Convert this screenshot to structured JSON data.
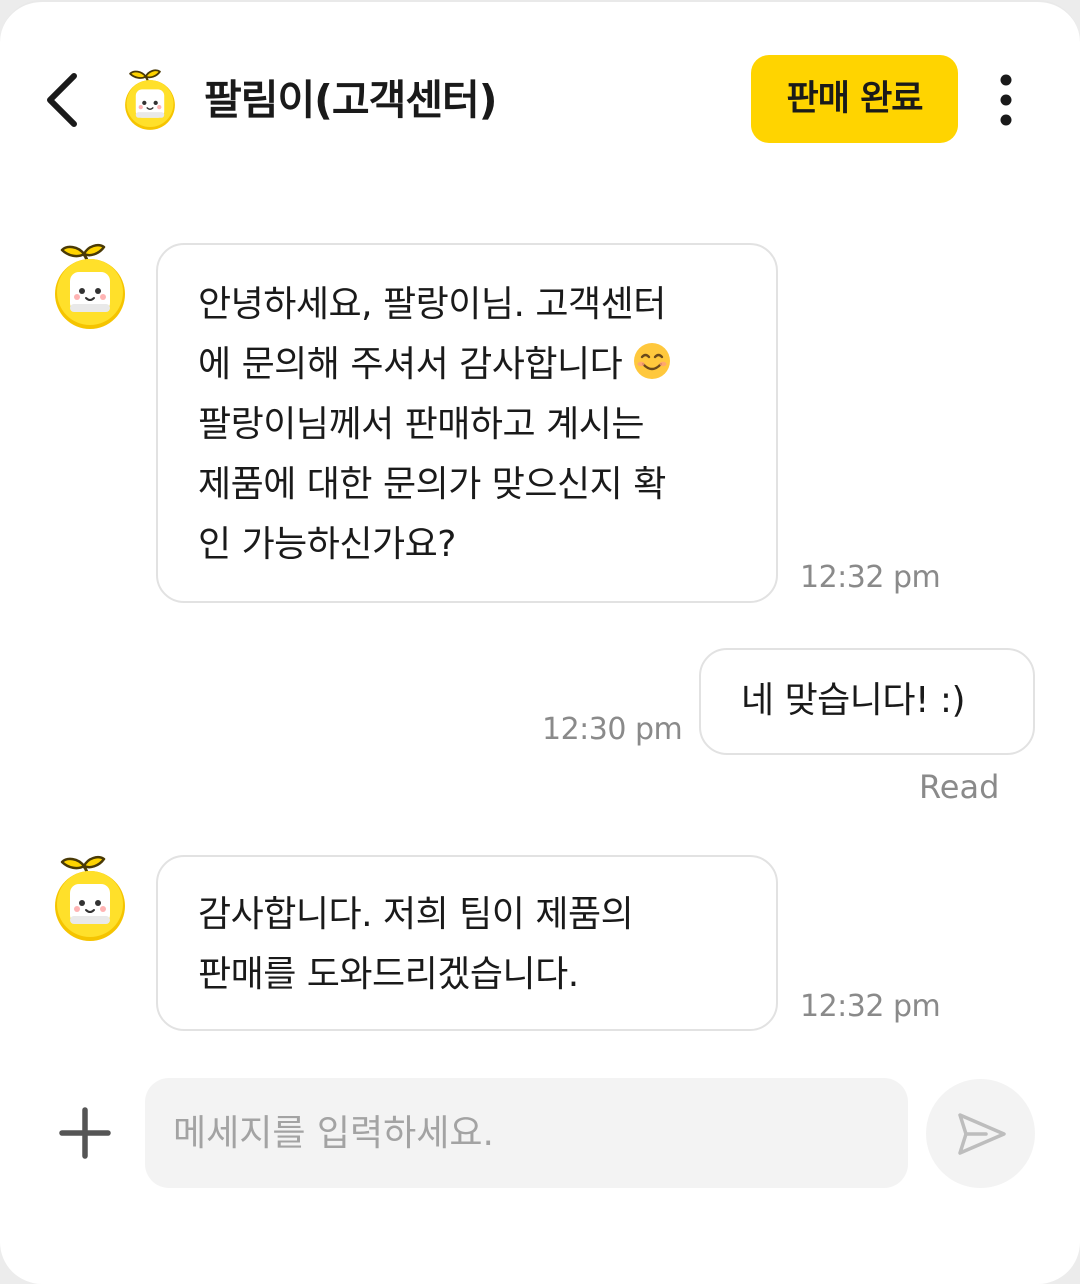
{
  "header": {
    "title": "팔림이(고객센터)",
    "action_label": "판매 완료",
    "back_icon": "chevron-left-icon",
    "menu_icon": "kebab-menu-icon",
    "avatar_icon": "mascot-avatar-icon"
  },
  "messages": [
    {
      "direction": "incoming",
      "lines": [
        "안녕하세요, 팔랑이님. 고객센터",
        "에 문의해 주셔서 감사합니다",
        "팔랑이님께서 판매하고 계시는",
        "제품에 대한 문의가 맞으신지 확",
        "인 가능하신가요?"
      ],
      "emoji": "smiling-face-emoji",
      "time": "12:32 pm"
    },
    {
      "direction": "outgoing",
      "lines": [
        "네 맞습니다! :)"
      ],
      "time": "12:30 pm",
      "status": "Read"
    },
    {
      "direction": "incoming",
      "lines": [
        "감사합니다. 저희 팀이 제품의",
        "판매를 도와드리겠습니다."
      ],
      "time": "12:32 pm"
    }
  ],
  "composer": {
    "placeholder": "메세지를 입력하세요.",
    "value": "",
    "attach_icon": "plus-icon",
    "send_icon": "send-icon"
  },
  "colors": {
    "accent": "#ffd400",
    "bubble_border": "#e2e2e2",
    "meta_text": "#8a8a8a",
    "input_bg": "#f3f3f3"
  }
}
